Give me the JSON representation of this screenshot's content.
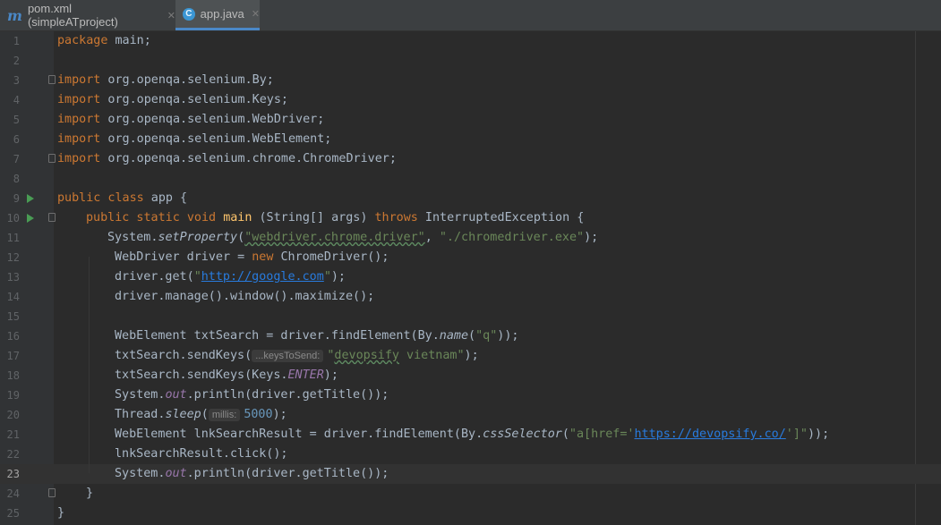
{
  "tabs": [
    {
      "label": "pom.xml (simpleATproject)",
      "icon": "maven-icon",
      "active": false
    },
    {
      "label": "app.java",
      "icon": "java-class-icon",
      "active": true
    }
  ],
  "editor": {
    "current_line": 23,
    "lines": [
      {
        "n": "1"
      },
      {
        "n": "2"
      },
      {
        "n": "3"
      },
      {
        "n": "4"
      },
      {
        "n": "5"
      },
      {
        "n": "6"
      },
      {
        "n": "7"
      },
      {
        "n": "8"
      },
      {
        "n": "9"
      },
      {
        "n": "10"
      },
      {
        "n": "11"
      },
      {
        "n": "12"
      },
      {
        "n": "13"
      },
      {
        "n": "14"
      },
      {
        "n": "15"
      },
      {
        "n": "16"
      },
      {
        "n": "17"
      },
      {
        "n": "18"
      },
      {
        "n": "19"
      },
      {
        "n": "20"
      },
      {
        "n": "21"
      },
      {
        "n": "22"
      },
      {
        "n": "23"
      },
      {
        "n": "24"
      },
      {
        "n": "25"
      }
    ],
    "code": {
      "l1": {
        "kw": "package",
        "rest": " main;"
      },
      "l3": {
        "kw": "import",
        "rest": " org.openqa.selenium.By;"
      },
      "l4": {
        "kw": "import",
        "rest": " org.openqa.selenium.Keys;"
      },
      "l5": {
        "kw": "import",
        "rest": " org.openqa.selenium.WebDriver;"
      },
      "l6": {
        "kw": "import",
        "rest": " org.openqa.selenium.WebElement;"
      },
      "l7": {
        "kw": "import",
        "rest": " org.openqa.selenium.chrome.ChromeDriver;"
      },
      "l9": {
        "kw": "public class",
        "rest": " app {"
      },
      "l10": {
        "kw1": "public static void",
        "fn": "main",
        "a": " (String[] args) ",
        "kw2": "throws",
        "b": " InterruptedException {"
      },
      "l11": {
        "a": "System.",
        "fn": "setProperty",
        "b": "(",
        "s1": "\"webdriver.chrome.driver\"",
        "c": ", ",
        "s2": "\"./chromedriver.exe\"",
        "d": ");"
      },
      "l12": {
        "a": " WebDriver driver = ",
        "kw": "new",
        "b": " ChromeDriver();"
      },
      "l13": {
        "a": "driver.get(",
        "q1": "\"",
        "url": "http://google.com",
        "q2": "\"",
        "b": ");"
      },
      "l14": {
        "a": "driver.manage().window().maximize();"
      },
      "l16": {
        "a": "WebElement txtSearch = driver.findElement(By.",
        "fn": "name",
        "b": "(",
        "s": "\"q\"",
        "c": "));"
      },
      "l17": {
        "a": "txtSearch.sendKeys(",
        "hint": "...keysToSend:",
        "s1": "\"",
        "word": "devopsify",
        "s2": " vietnam\"",
        "b": ");"
      },
      "l18": {
        "a": "txtSearch.sendKeys(Keys.",
        "fn": "ENTER",
        "b": ");"
      },
      "l19": {
        "a": "System.",
        "fn": "out",
        "b": ".println(driver.getTitle());"
      },
      "l20": {
        "a": "Thread.",
        "fn": "sleep",
        "b": "(",
        "hint": "millis:",
        "num": "5000",
        "c": ");"
      },
      "l21": {
        "a": "WebElement lnkSearchResult = driver.findElement(By.",
        "fn": "cssSelector",
        "b": "(",
        "s1": "\"a[href='",
        "url": "https://devopsify.co/",
        "s2": "']\"",
        "c": "));"
      },
      "l22": {
        "a": "lnkSearchResult.click();"
      },
      "l23": {
        "a": "System.",
        "fn": "out",
        "b": ".println(driver.getTitle());"
      },
      "l24": {
        "a": "}"
      },
      "l25": {
        "a": "}"
      }
    }
  },
  "colors": {
    "background": "#2b2b2b",
    "keyword": "#cc7832",
    "string": "#6a8759",
    "static": "#9876aa",
    "function": "#ffc66d",
    "number": "#6897bb",
    "link": "#287bde"
  }
}
